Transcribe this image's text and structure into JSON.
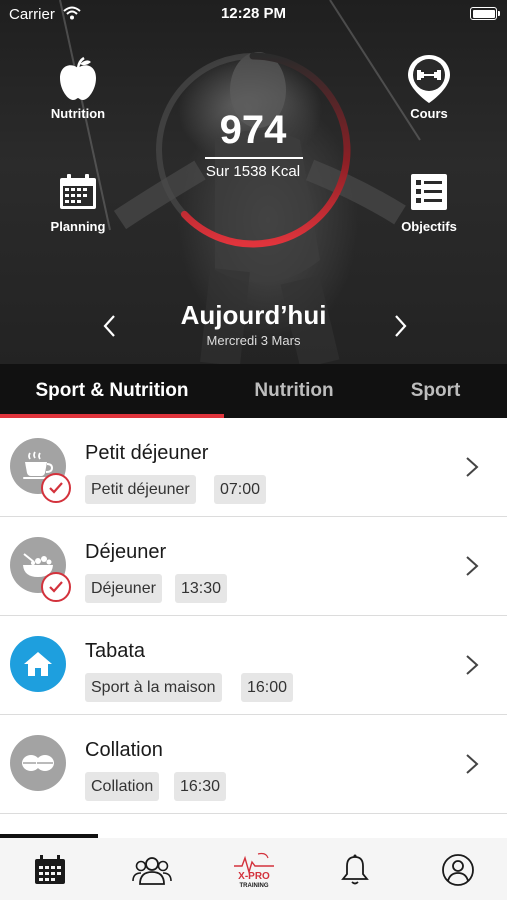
{
  "status_bar": {
    "carrier": "Carrier",
    "time": "12:28 PM"
  },
  "hero": {
    "quick_links": {
      "nutrition": "Nutrition",
      "cours": "Cours",
      "planning": "Planning",
      "objectifs": "Objectifs"
    },
    "calories": {
      "value": "974",
      "subtitle": "Sur 1538 Kcal",
      "progress": 0.63
    },
    "day": {
      "title": "Aujourd’hui",
      "date": "Mercredi 3 Mars"
    }
  },
  "tabs": [
    {
      "label": "Sport & Nutrition",
      "active": true
    },
    {
      "label": "Nutrition",
      "active": false
    },
    {
      "label": "Sport",
      "active": false
    }
  ],
  "items": [
    {
      "title": "Petit déjeuner",
      "tag": "Petit déjeuner",
      "time": "07:00",
      "icon": "coffee-cup-icon",
      "done": true
    },
    {
      "title": "Déjeuner",
      "tag": "Déjeuner",
      "time": "13:30",
      "icon": "salad-bowl-icon",
      "done": true
    },
    {
      "title": "Tabata",
      "tag": "Sport à la maison",
      "time": "16:00",
      "icon": "home-icon",
      "done": false
    },
    {
      "title": "Collation",
      "tag": "Collation",
      "time": "16:30",
      "icon": "macaron-icon",
      "done": false
    }
  ],
  "tabbar": {
    "items": [
      "calendar-icon",
      "community-icon",
      "xpro-training-logo",
      "bell-icon",
      "profile-icon"
    ],
    "logo_text": {
      "line1": "X-PRO",
      "line2": "TRAINING"
    }
  },
  "colors": {
    "accent": "#e0343c",
    "sport_blue": "#1e9fde",
    "meal_gray": "#a3a3a3"
  }
}
